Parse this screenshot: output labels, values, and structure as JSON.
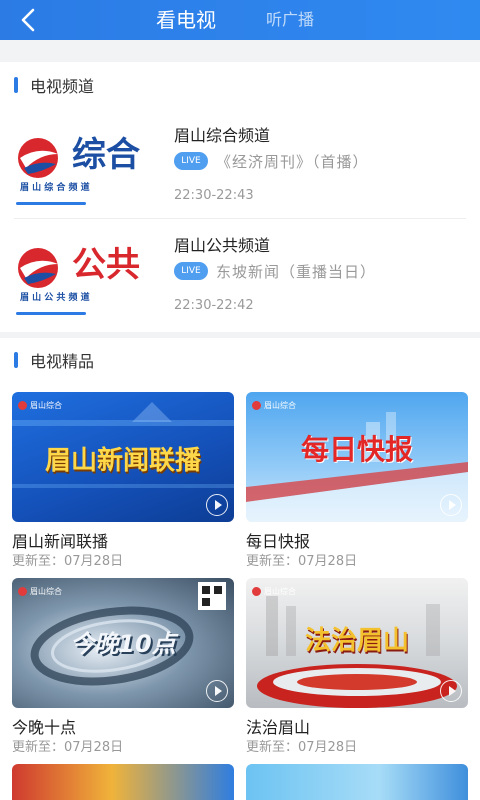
{
  "header": {
    "tabs": [
      "看电视",
      "听广播"
    ]
  },
  "tv_channels": {
    "section_title": "电视频道",
    "items": [
      {
        "name": "眉山综合频道",
        "badge": "LIVE",
        "program": "《经济周刊》（首播）",
        "time": "22:30-22:43",
        "logo_text": "综合",
        "logo_sub": "眉 山 综 合 频 道"
      },
      {
        "name": "眉山公共频道",
        "badge": "LIVE",
        "program": "东坡新闻（重播当日）",
        "time": "22:30-22:42",
        "logo_text": "公共",
        "logo_sub": "眉 山 公 共 频 道"
      }
    ]
  },
  "tv_featured": {
    "section_title": "电视精品",
    "items": [
      {
        "title": "眉山新闻联播",
        "update": "更新至：07月28日",
        "thumb_text": "眉山新闻联播",
        "thumb_logo": "眉山综合"
      },
      {
        "title": "每日快报",
        "update": "更新至：07月28日",
        "thumb_text": "每日快报",
        "thumb_logo": "眉山综合"
      },
      {
        "title": "今晚十点",
        "update": "更新至：07月28日",
        "thumb_text": "今晚10点",
        "thumb_logo": "眉山综合"
      },
      {
        "title": "法治眉山",
        "update": "更新至：07月28日",
        "thumb_text": "法治眉山",
        "thumb_logo": "眉山综合"
      }
    ]
  },
  "colors": {
    "header_bg": "#2c7be5",
    "accent_blue": "#2c7be5",
    "live_badge": "#4f9ef0",
    "logo_red": "#d9272e"
  }
}
